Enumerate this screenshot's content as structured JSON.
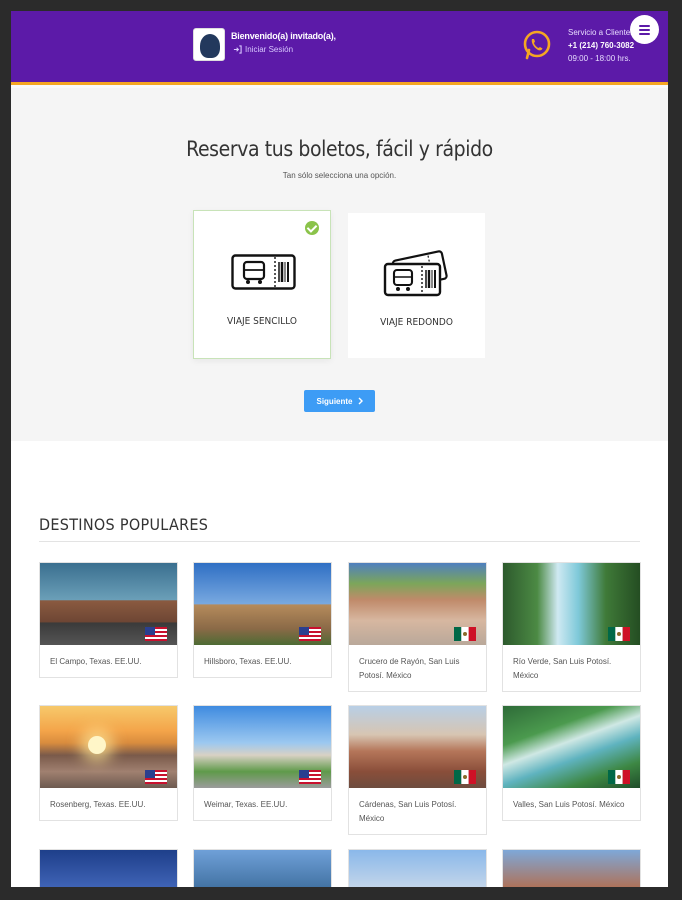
{
  "header": {
    "welcome": "Bienvenido(a) invitado(a),",
    "login": "Iniciar Sesión",
    "service_label": "Servicio a Clientes",
    "service_phone": "+1 (214) 760-3082",
    "service_hours": "09:00 - 18:00 hrs."
  },
  "hero": {
    "title": "Reserva tus boletos, fácil y rápido",
    "subtitle": "Tan sólo selecciona una opción.",
    "options": [
      {
        "label": "VIAJE SENCILLO",
        "selected": true
      },
      {
        "label": "VIAJE REDONDO",
        "selected": false
      }
    ],
    "next_label": "Siguiente"
  },
  "destinations": {
    "title": "DESTINOS POPULARES",
    "cards": [
      {
        "name": "El Campo, Texas. EE.UU.",
        "flag": "usa"
      },
      {
        "name": "Hillsboro, Texas. EE.UU.",
        "flag": "usa"
      },
      {
        "name": "Crucero de Rayón, San Luis Potosí. México",
        "flag": "mexico"
      },
      {
        "name": "Río Verde, San Luis Potosí. México",
        "flag": "mexico"
      },
      {
        "name": "Rosenberg, Texas. EE.UU.",
        "flag": "usa"
      },
      {
        "name": "Weimar, Texas. EE.UU.",
        "flag": "usa"
      },
      {
        "name": "Cárdenas, San Luis Potosí. México",
        "flag": "mexico"
      },
      {
        "name": "Valles, San Luis Potosí. México",
        "flag": "mexico"
      }
    ]
  },
  "colors": {
    "header_bg": "#5c1aa8",
    "accent_orange": "#f5a623",
    "button_blue": "#3d9cf5",
    "check_green": "#8bc34a"
  },
  "icons": [
    "user-avatar",
    "login-arrow-icon",
    "whatsapp-icon",
    "menu-icon",
    "check-icon",
    "bus-ticket-icon",
    "double-bus-ticket-icon",
    "chevron-right-icon",
    "usa-flag-icon",
    "mexico-flag-icon"
  ]
}
